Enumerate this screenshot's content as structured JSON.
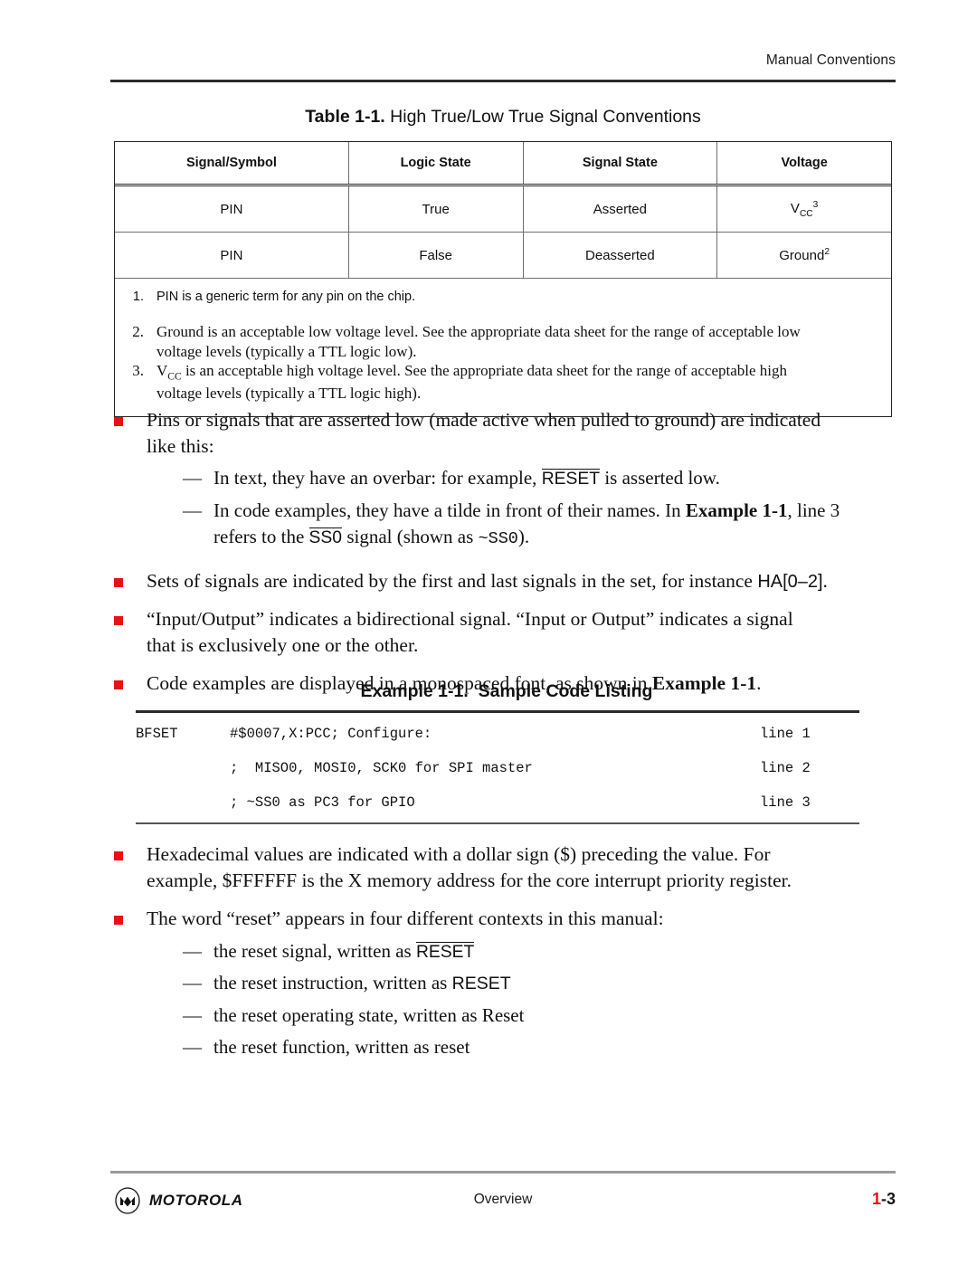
{
  "header": {
    "running_head": "Manual Conventions"
  },
  "table": {
    "caption_number": "Table 1-1.",
    "caption_title": "High True/Low True Signal Conventions",
    "columns": [
      "Signal/Symbol",
      "Logic State",
      "Signal State",
      "Voltage"
    ],
    "rows": [
      {
        "signal_symbol": "PIN",
        "logic_state": "True",
        "signal_state": "Asserted",
        "voltage_base": "V",
        "voltage_sub": "CC",
        "voltage_sup": "3"
      },
      {
        "signal_symbol": "PIN",
        "logic_state": "False",
        "signal_state": "Deasserted",
        "voltage_base": "Ground",
        "voltage_sub": "",
        "voltage_sup": "2"
      }
    ],
    "footnotes": [
      {
        "number": "1.",
        "text": "PIN is a generic term for any pin on the chip."
      },
      {
        "number": "2.",
        "line1": "Ground is an acceptable low voltage level. See the appropriate data sheet for the range of acceptable low",
        "line2": "voltage levels (typically a TTL logic low)."
      },
      {
        "number": "3.",
        "lead_base": "V",
        "lead_sub": "CC",
        "line1": " is an acceptable high voltage level. See the appropriate data sheet for the range of acceptable high",
        "line2": "voltage levels (typically a TTL logic high)."
      }
    ]
  },
  "bullets_upper": [
    {
      "text_line1": "Pins or signals that are asserted low (made active when pulled to ground) are indicated",
      "text_line2": "like this:",
      "sub": [
        {
          "pre": "In text, they have an overbar: for example, ",
          "overbar": "RESET",
          "post": " is asserted low."
        },
        {
          "pre": "In code examples, they have a tilde in front of their names. In ",
          "bold": "Example 1-1",
          "mid": ", line 3",
          "line2_pre": "refers to the ",
          "overbar": "SS0",
          "line2_mid": " signal (shown as ",
          "mono": "~SS0",
          "line2_post": ")."
        }
      ]
    },
    {
      "pre": "Sets of signals are indicated by the first and last signals in the set, for instance ",
      "sans": "HA[0–2]",
      "post": "."
    },
    {
      "text_line1": "“Input/Output” indicates a bidirectional signal. “Input or Output” indicates a signal",
      "text_line2": "that is exclusively one or the other."
    },
    {
      "pre": "Code examples are displayed in a monospaced font, as shown in ",
      "bold": "Example 1-1",
      "post": "."
    }
  ],
  "example": {
    "caption_number": "Example 1-1.",
    "caption_title": "Sample Code Listing",
    "lines": [
      {
        "op": "BFSET",
        "body": "#$0007,X:PCC; Configure:",
        "line_no": "line 1"
      },
      {
        "op": "",
        "body": ";  MISO0, MOSI0, SCK0 for SPI master",
        "line_no": "line 2"
      },
      {
        "op": "",
        "body": "; ~SS0 as PC3 for GPIO",
        "line_no": "line 3"
      }
    ]
  },
  "bullets_lower": [
    {
      "text_line1": "Hexadecimal values are indicated with a dollar sign ($) preceding the value. For",
      "text_line2": "example, $FFFFFF is the X memory address for the core interrupt priority register."
    },
    {
      "text_line1": "The word “reset” appears in four different contexts in this manual:",
      "sub": [
        {
          "pre": "the reset signal, written as ",
          "overbar": "RESET",
          "post": ""
        },
        {
          "pre": "the reset instruction, written as ",
          "sans": "RESET",
          "post": ""
        },
        {
          "pre": "the reset operating state, written as Reset",
          "post": ""
        },
        {
          "pre": "the reset function, written as reset",
          "post": ""
        }
      ]
    }
  ],
  "footer": {
    "brand": "MOTOROLA",
    "center_text": "Overview",
    "page_chapter": "1",
    "page_suffix": "-3"
  },
  "colors": {
    "bullet_red": "#e8110f",
    "rule_dark": "#2b2b2b",
    "rule_gray": "#9a9a9a"
  }
}
